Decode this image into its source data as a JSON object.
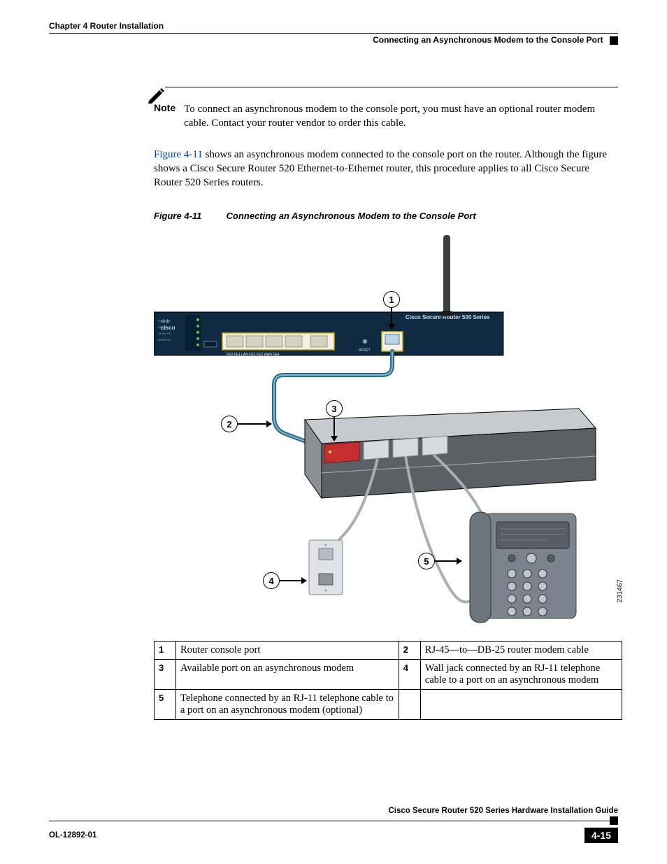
{
  "header": {
    "chapter": "Chapter 4      Router Installation",
    "section": "Connecting an Asynchronous Modem to the Console Port"
  },
  "note": {
    "label": "Note",
    "text": "To connect an asynchronous modem to the console port, you must have an optional router modem cable. Contact your router vendor to order this cable."
  },
  "paragraph": {
    "link": "Figure 4-11",
    "rest": " shows an asynchronous modem connected to the console port on the router. Although the figure shows a Cisco Secure Router 520 Ethernet-to-Ethernet router, this procedure applies to all Cisco Secure Router 520 Series routers."
  },
  "figure": {
    "label": "Figure 4-11",
    "title": "Connecting an Asynchronous Modem to the Console Port",
    "image_id": "231467",
    "router_text": {
      "brand": "cisco",
      "model_line": "Cisco  Secure  Router  500  Series",
      "port_labels": "FE0     FE1    LAN    FE2       FE3            WAN FE4",
      "reset": "RESET",
      "leds": [
        "SYS PWR",
        "WAN FE4",
        "WLAN OK",
        "WLAN GK",
        "",
        ""
      ]
    },
    "callouts": {
      "c1": "1",
      "c2": "2",
      "c3": "3",
      "c4": "4",
      "c5": "5"
    }
  },
  "key": {
    "r1a": "Router console port",
    "r1b": "RJ-45—to—DB-25 router modem cable",
    "r2a": "Available port on an asynchronous modem",
    "r2b": "Wall jack connected by an RJ-11 telephone cable to a port on an asynchronous modem",
    "r3a": "Telephone connected by an RJ-11 telephone cable to a port on an asynchronous modem (optional)",
    "n1": "1",
    "n2": "2",
    "n3": "3",
    "n4": "4",
    "n5": "5"
  },
  "footer": {
    "guide": "Cisco Secure Router 520 Series Hardware Installation Guide",
    "doc_id": "OL-12892-01",
    "page": "4-15"
  }
}
